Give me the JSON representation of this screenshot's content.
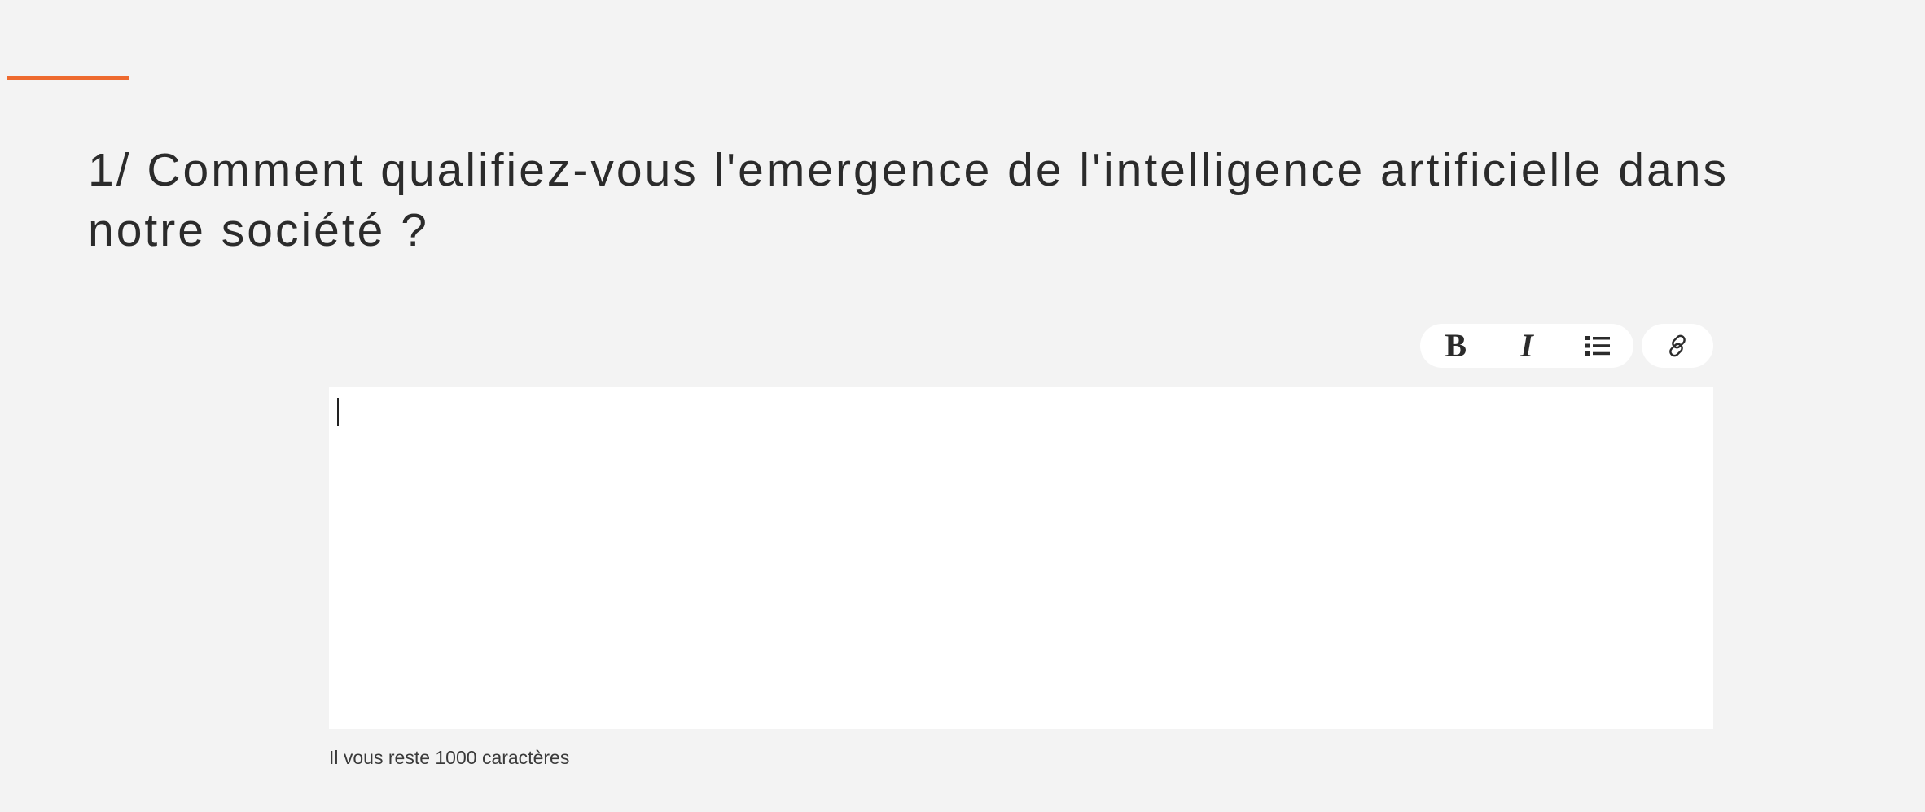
{
  "question": {
    "title": "1/ Comment qualifiez-vous l'emergence de l'intelligence artificielle dans notre société ?"
  },
  "editor": {
    "value": "",
    "remaining_text": "Il vous reste 1000 caractères"
  },
  "toolbar": {
    "format_buttons": [
      {
        "icon": "bold-icon",
        "glyph": "B"
      },
      {
        "icon": "italic-icon",
        "glyph": "I"
      },
      {
        "icon": "bulleted-list-icon"
      }
    ],
    "link_button": {
      "icon": "link-icon"
    }
  },
  "colors": {
    "accent": "#ee6a2f",
    "background": "#f3f3f3",
    "surface": "#ffffff",
    "text": "#2b2b2b"
  }
}
